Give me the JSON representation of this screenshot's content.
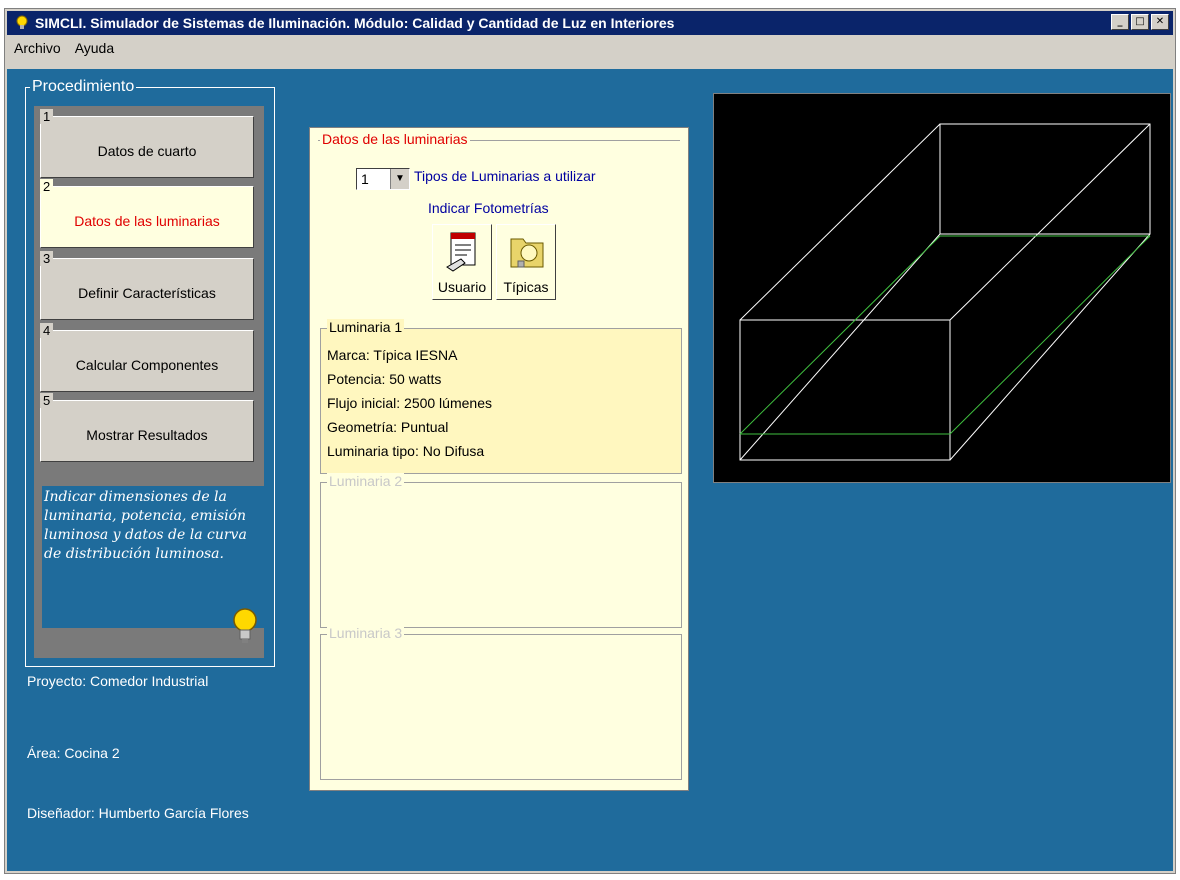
{
  "window": {
    "title": "SIMCLI. Simulador de Sistemas de Iluminación. Módulo: Calidad y Cantidad de Luz en Interiores"
  },
  "menu": {
    "items": [
      "Archivo",
      "Ayuda"
    ]
  },
  "procedure": {
    "title": "Procedimiento",
    "steps": [
      {
        "num": "1",
        "label": "Datos de cuarto"
      },
      {
        "num": "2",
        "label": "Datos de las luminarias"
      },
      {
        "num": "3",
        "label": "Definir Características"
      },
      {
        "num": "4",
        "label": "Calcular Componentes"
      },
      {
        "num": "5",
        "label": "Mostrar Resultados"
      }
    ],
    "hint": "Indicar dimensiones de la luminaria, potencia, emisión luminosa y datos de la curva de distribución luminosa."
  },
  "info": {
    "proyecto": "Proyecto: Comedor Industrial",
    "area": "Área: Cocina 2",
    "disenador": "Diseñador: Humberto García Flores"
  },
  "luminarias": {
    "legend": "Datos de las luminarias",
    "count": "1",
    "count_label": "Tipos de Luminarias a utilizar",
    "fotometrias_label": "Indicar Fotometrías",
    "usuario_label": "Usuario",
    "tipicas_label": "Típicas",
    "lum1": {
      "legend": "Luminaria 1",
      "marca": "Marca: Típica IESNA",
      "potencia": "Potencia: 50 watts",
      "flujo": "Flujo inicial: 2500 lúmenes",
      "geometria": "Geometría: Puntual",
      "tipo": "Luminaria tipo:  No Difusa"
    },
    "lum2": {
      "legend": "Luminaria 2"
    },
    "lum3": {
      "legend": "Luminaria 3"
    }
  },
  "colors": {
    "accent": "#0a246a",
    "background": "#1f6b9c",
    "active_text": "#e00000"
  }
}
